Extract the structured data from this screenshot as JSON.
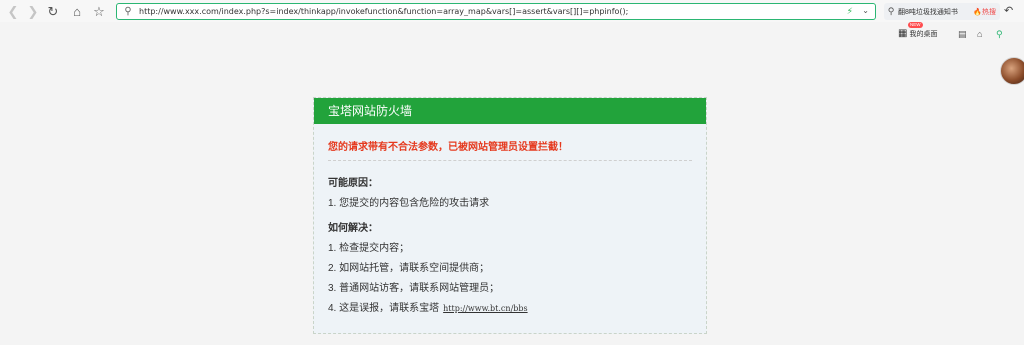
{
  "browser": {
    "url": "http://www.xxx.com/index.php?s=index/thinkapp/invokefunction&function=array_map&vars[]=assert&vars[][]=phpinfo();",
    "search_query": "翻8吨垃圾找通知书",
    "search_hot": "热搜",
    "desktop_label": "我的桌面",
    "new_badge": "NEW"
  },
  "card": {
    "title": "宝塔网站防火墙",
    "alert": "您的请求带有不合法参数，已被网站管理员设置拦截！",
    "reasons_title": "可能原因：",
    "reasons": [
      "1.  您提交的内容包含危险的攻击请求"
    ],
    "solutions_title": "如何解决：",
    "solutions": [
      "1.  检查提交内容；",
      "2.  如网站托管，请联系空间提供商；",
      "3.  普通网站访客，请联系网站管理员；",
      "4.  这是误报，请联系宝塔"
    ],
    "link": "http://www.bt.cn/bbs"
  }
}
